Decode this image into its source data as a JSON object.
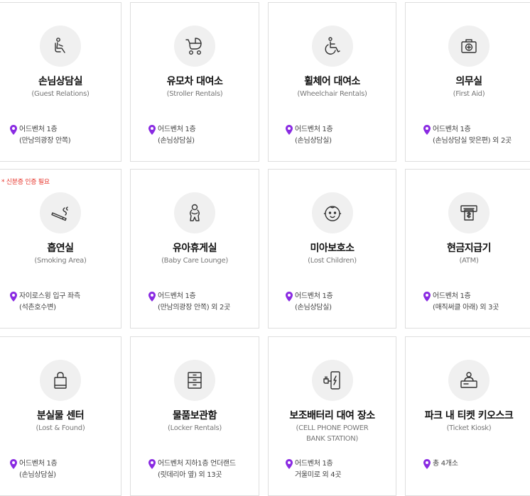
{
  "accent_color": "#8a2be2",
  "cards": [
    {
      "title": "손님상담실",
      "subtitle": "(Guest Relations)",
      "loc1": "어드벤처 1층",
      "loc2": "(만남의광장 안쪽)",
      "icon": "chair-icon"
    },
    {
      "title": "유모차 대여소",
      "subtitle": "(Stroller Rentals)",
      "loc1": "어드벤처 1층",
      "loc2": "(손님상담실)",
      "icon": "stroller-icon"
    },
    {
      "title": "휠체어 대여소",
      "subtitle": "(Wheelchair Rentals)",
      "loc1": "어드벤처 1층",
      "loc2": "(손님상담실)",
      "icon": "wheelchair-icon"
    },
    {
      "title": "의무실",
      "subtitle": "(First Aid)",
      "loc1": "어드벤처 1층",
      "loc2": "(손님상담실 맞은편) 외 2곳",
      "icon": "first-aid-icon"
    },
    {
      "title": "흡연실",
      "subtitle": "(Smoking Area)",
      "loc1": "자이로스윙 입구 좌측",
      "loc2": "(석촌호수변)",
      "icon": "smoking-icon",
      "notice": "* 신분증 인증 필요"
    },
    {
      "title": "유아휴게실",
      "subtitle": "(Baby Care Lounge)",
      "loc1": "어드벤처 1층",
      "loc2": "(만남의광장 안쪽) 외 2곳",
      "icon": "baby-care-icon"
    },
    {
      "title": "미아보호소",
      "subtitle": "(Lost Children)",
      "loc1": "어드벤처 1층",
      "loc2": "(손님상담실)",
      "icon": "child-face-icon"
    },
    {
      "title": "현금지급기",
      "subtitle": "(ATM)",
      "loc1": "어드벤처 1층",
      "loc2": "(매직써클 아래) 외 3곳",
      "icon": "atm-icon"
    },
    {
      "title": "분실물 센터",
      "subtitle": "(Lost & Found)",
      "loc1": "어드벤처 1층",
      "loc2": "(손님상담실)",
      "icon": "bag-icon"
    },
    {
      "title": "물품보관함",
      "subtitle": "(Locker Rentals)",
      "loc1": "어드벤처 지하1층 언더랜드",
      "loc2": "(릿데리아 옆) 외 13곳",
      "icon": "locker-icon"
    },
    {
      "title": "보조배터리 대여 장소",
      "subtitle": "(CELL PHONE POWER BANK STATION)",
      "loc1": "어드벤처 1층",
      "loc2": "거울미로 외 4곳",
      "icon": "power-bank-icon"
    },
    {
      "title": "파크 내 티켓 키오스크",
      "subtitle": "(Ticket Kiosk)",
      "loc1": "총 4개소",
      "loc2": "",
      "icon": "kiosk-icon"
    }
  ]
}
